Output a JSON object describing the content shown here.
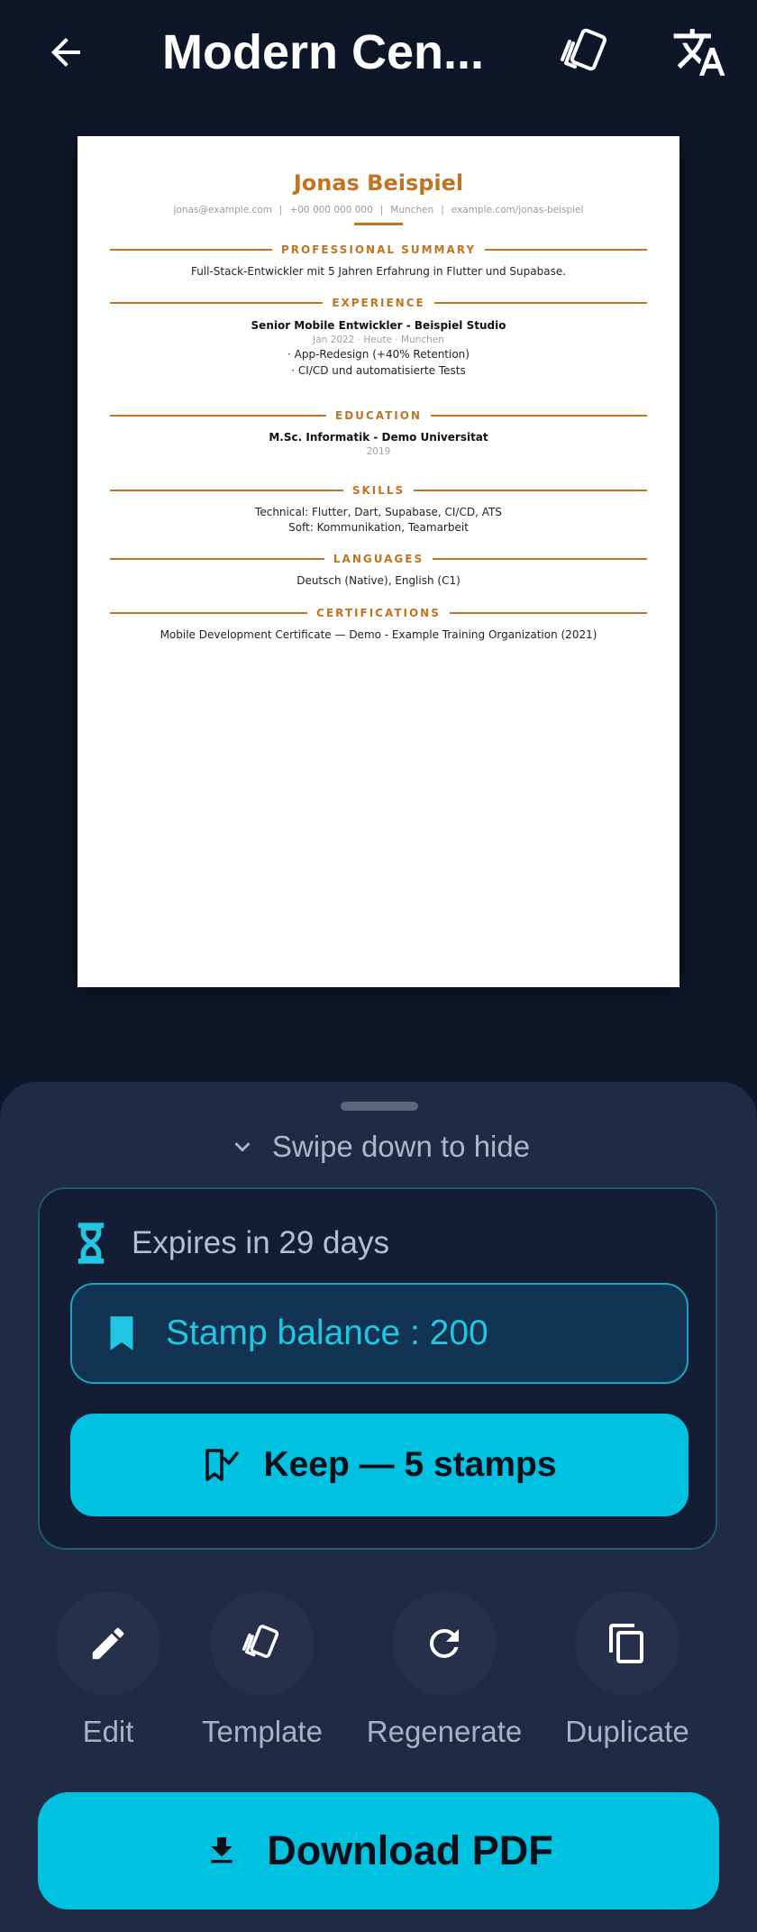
{
  "header": {
    "title": "Modern Cen...",
    "back_icon": "arrow-left-icon",
    "template_icon": "template-cards-icon",
    "translate_icon": "translate-icon"
  },
  "resume": {
    "name": "Jonas Beispiel",
    "contact": [
      "jonas@example.com",
      "+00 000 000 000",
      "Munchen",
      "example.com/jonas-beispiel"
    ],
    "summary_heading": "PROFESSIONAL SUMMARY",
    "summary_text": "Full-Stack-Entwickler mit 5 Jahren Erfahrung in Flutter und Supabase.",
    "experience_heading": "EXPERIENCE",
    "job_title": "Senior Mobile Entwickler - Beispiel Studio",
    "job_meta": "Jan 2022 · Heute · Munchen",
    "job_bullet_1": "· App-Redesign (+40% Retention)",
    "job_bullet_2": "· CI/CD und automatisierte Tests",
    "education_heading": "EDUCATION",
    "degree": "M.Sc. Informatik - Demo Universitat",
    "degree_year": "2019",
    "skills_heading": "SKILLS",
    "skills_technical": "Technical: Flutter, Dart, Supabase, CI/CD, ATS",
    "skills_soft": "Soft: Kommunikation, Teamarbeit",
    "languages_heading": "LANGUAGES",
    "languages_text": "Deutsch (Native), English (C1)",
    "certifications_heading": "CERTIFICATIONS",
    "certifications_text": "Mobile Development Certificate — Demo - Example Training Organization (2021)",
    "accent_color": "#c1731f"
  },
  "sheet": {
    "swipe_hint": "Swipe down to hide",
    "expires_text": "Expires in 29 days",
    "stamp_balance": "Stamp balance : 200",
    "keep_label": "Keep — 5 stamps",
    "actions": [
      {
        "label": "Edit",
        "icon": "pencil-icon"
      },
      {
        "label": "Template",
        "icon": "template-cards-icon"
      },
      {
        "label": "Regenerate",
        "icon": "refresh-icon"
      },
      {
        "label": "Duplicate",
        "icon": "copy-icon"
      }
    ],
    "download_label": "Download PDF",
    "accent_color": "#00c1e0"
  }
}
